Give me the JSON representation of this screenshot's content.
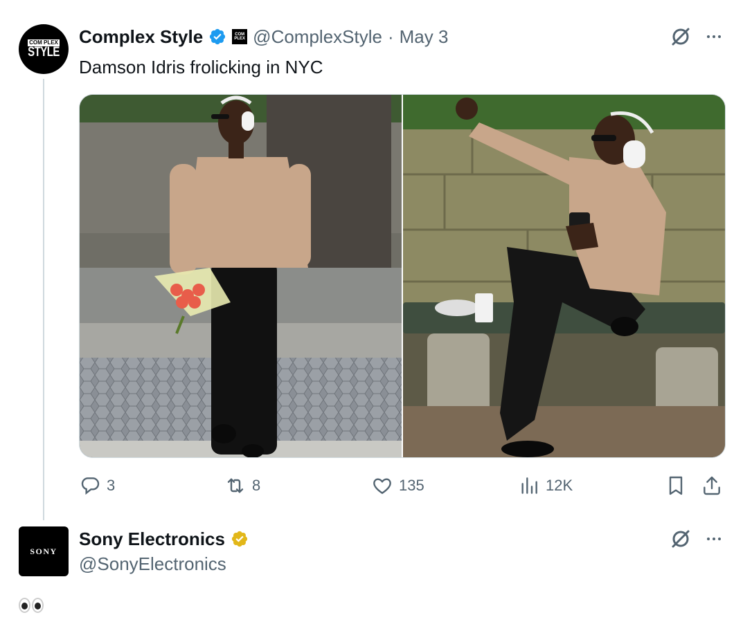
{
  "tweet1": {
    "author_name": "Complex Style",
    "avatar_text": "STYLE",
    "avatar_badge": "COM PLEX",
    "affiliate_badge": "COM PLEX",
    "handle": "@ComplexStyle",
    "separator": "·",
    "date": "May 3",
    "text": "Damson Idris frolicking in NYC",
    "verified_color": "#1d9bf0",
    "actions": {
      "replies": "3",
      "reposts": "8",
      "likes": "135",
      "views": "12K"
    }
  },
  "tweet2": {
    "author_name": "Sony Electronics",
    "avatar_text": "SONY",
    "handle": "@SonyElectronics",
    "verified_color": "#e2b719",
    "text_emoji": "👀"
  },
  "icons": {
    "grok": "grok-slash-circle-icon",
    "more": "more-dots-icon",
    "reply": "reply-bubble-icon",
    "repost": "repost-arrows-icon",
    "like": "heart-icon",
    "views": "views-bars-icon",
    "bookmark": "bookmark-icon",
    "share": "share-upload-icon"
  }
}
